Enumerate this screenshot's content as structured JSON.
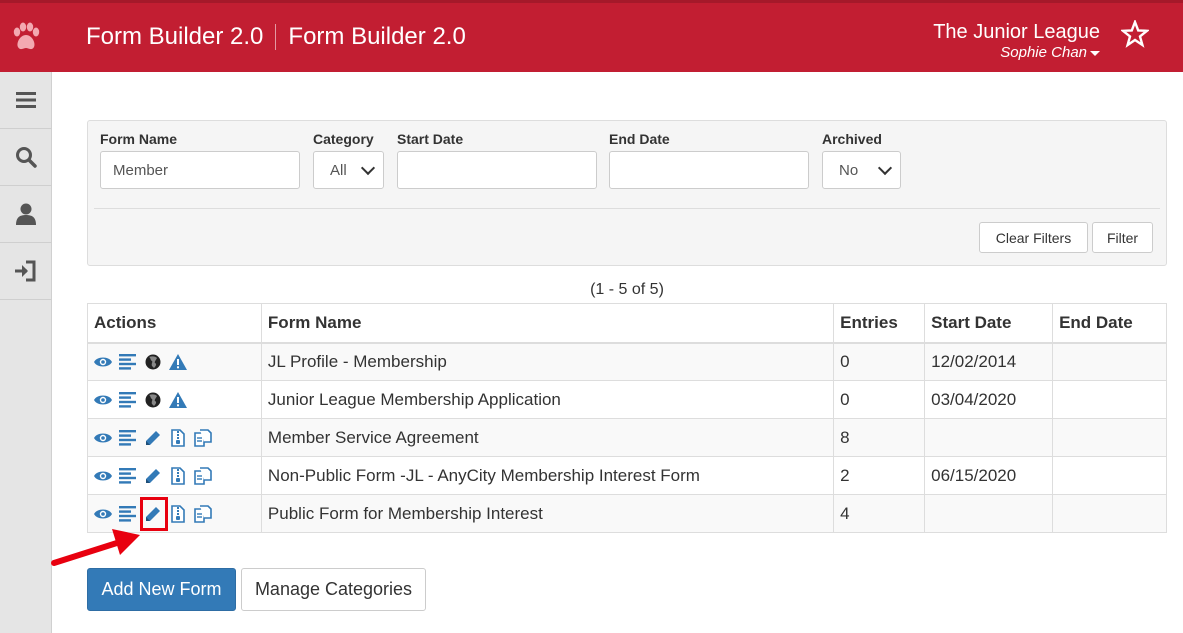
{
  "header": {
    "title_primary": "Form Builder 2.0",
    "title_secondary": "Form Builder 2.0",
    "org_name": "The Junior League",
    "user_name": "Sophie Chan",
    "brand_color": "#c21e32"
  },
  "sidebar": {
    "items": [
      {
        "icon": "menu-icon"
      },
      {
        "icon": "search-icon"
      },
      {
        "icon": "user-icon"
      },
      {
        "icon": "logout-icon"
      }
    ]
  },
  "filters": {
    "form_name": {
      "label": "Form Name",
      "value": "Member"
    },
    "category": {
      "label": "Category",
      "value": "All"
    },
    "start_date": {
      "label": "Start Date",
      "value": ""
    },
    "end_date": {
      "label": "End Date",
      "value": ""
    },
    "archived": {
      "label": "Archived",
      "value": "No"
    },
    "clear_label": "Clear Filters",
    "filter_label": "Filter"
  },
  "results_count": "(1 - 5 of 5)",
  "table": {
    "headers": [
      "Actions",
      "Form Name",
      "Entries",
      "Start Date",
      "End Date"
    ],
    "rows": [
      {
        "name": "JL Profile - Membership",
        "entries": "0",
        "start": "12/02/2014",
        "end": "",
        "entries_link": false,
        "actions": [
          "view-icon",
          "entries-list-icon",
          "globe-icon",
          "warning-icon"
        ]
      },
      {
        "name": "Junior League Membership Application",
        "entries": "0",
        "start": "03/04/2020",
        "end": "",
        "entries_link": false,
        "actions": [
          "view-icon",
          "entries-list-icon",
          "globe-icon",
          "warning-icon"
        ]
      },
      {
        "name": "Member Service Agreement",
        "entries": "8",
        "start": "",
        "end": "",
        "entries_link": true,
        "actions": [
          "view-icon",
          "entries-list-icon",
          "edit-pencil-icon",
          "archive-file-icon",
          "copy-icon"
        ]
      },
      {
        "name": "Non-Public Form -JL - AnyCity Membership Interest Form",
        "entries": "2",
        "start": "06/15/2020",
        "end": "",
        "entries_link": true,
        "actions": [
          "view-icon",
          "entries-list-icon",
          "edit-pencil-icon",
          "archive-file-icon",
          "copy-icon"
        ]
      },
      {
        "name": "Public Form for Membership Interest",
        "entries": "4",
        "start": "",
        "end": "",
        "entries_link": true,
        "actions": [
          "view-icon",
          "entries-list-icon",
          "edit-pencil-icon",
          "archive-file-icon",
          "copy-icon"
        ]
      }
    ]
  },
  "buttons": {
    "add_new_form": "Add New Form",
    "manage_categories": "Manage Categories"
  },
  "annotation_color": "#e8000f"
}
